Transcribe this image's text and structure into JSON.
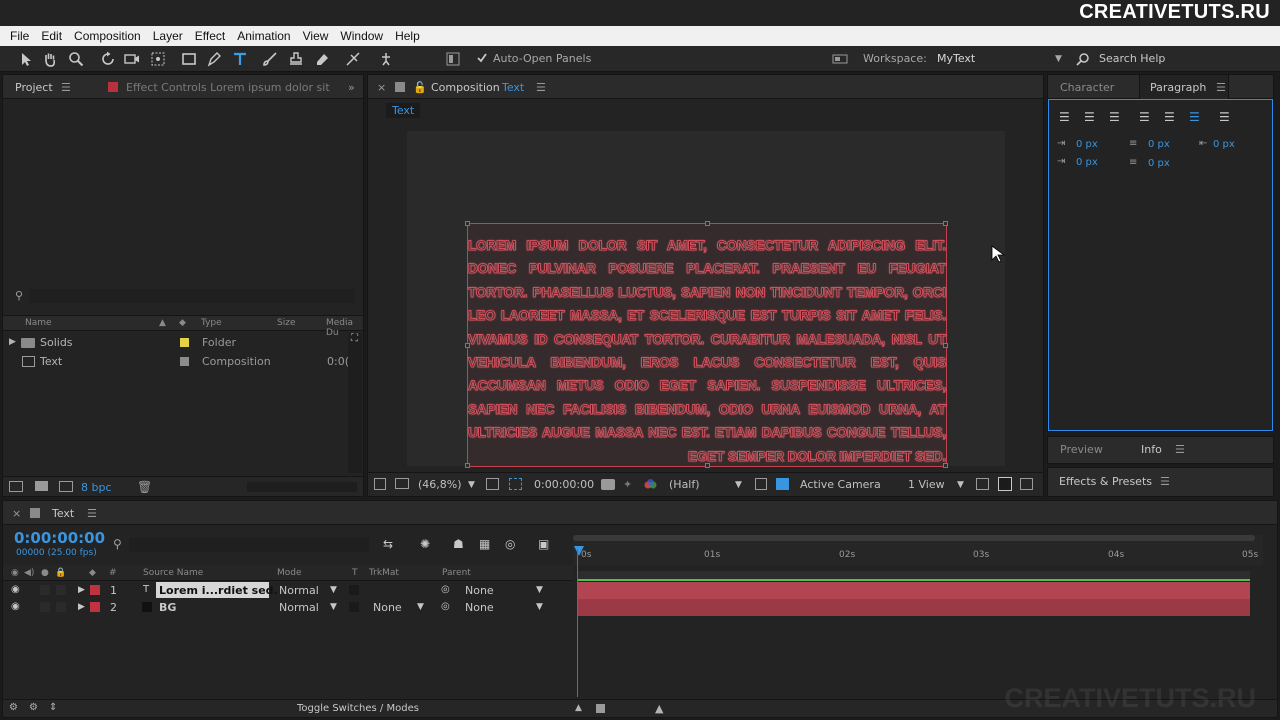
{
  "watermark": "CREATIVETUTS.RU",
  "menu": [
    "File",
    "Edit",
    "Composition",
    "Layer",
    "Effect",
    "Animation",
    "View",
    "Window",
    "Help"
  ],
  "toolbar": {
    "auto_open": "Auto-Open Panels",
    "workspace_label": "Workspace:",
    "workspace_value": "MyText",
    "search_help": "Search Help"
  },
  "project": {
    "tab": "Project",
    "effect_controls": "Effect Controls Lorem ipsum dolor sit",
    "columns": {
      "name": "Name",
      "type": "Type",
      "size": "Size",
      "media": "Media Du"
    },
    "items": [
      {
        "name": "Solids",
        "type": "Folder",
        "label_color": "#e6d24a",
        "duration": ""
      },
      {
        "name": "Text",
        "type": "Composition",
        "label_color": "#8c8c8c",
        "duration": "0:0("
      }
    ],
    "bpc": "8 bpc"
  },
  "composition": {
    "tab_prefix": "Composition",
    "tab_name": "Text",
    "subtab": "Text",
    "text": "Lorem ipsum dolor sit amet, consectetur adipiscing elit. Donec pulvinar posuere placerat. Praesent eu feugiat tortor. Phasellus luctus, sapien non tincidunt tempor, orci leo laoreet massa, et scelerisque est turpis sit amet felis. Vivamus id consequat tortor. Curabitur malesuada, nisl ut vehicula bibendum, eros lacus consectetur est, quis accumsan metus odio eget sapien. Suspendisse ultrices, sapien nec facilisis bibendum, odio urna euismod urna, at ultricies augue massa nec est. Etiam dapibus congue tellus, eget semper dolor imperdiet sed.",
    "zoom": "(46,8%)",
    "timecode": "0:00:00:00",
    "resolution": "(Half)",
    "camera": "Active Camera",
    "view": "1 View",
    "text_color": "#d0505c"
  },
  "character": {
    "tab_character": "Character",
    "tab_paragraph": "Paragraph"
  },
  "paragraph_values": {
    "indent_left": "0 px",
    "space_before": "0 px",
    "indent_right": "0 px",
    "first_line": "0 px",
    "space_after": "0 px"
  },
  "info": {
    "preview": "Preview",
    "info": "Info"
  },
  "effects": {
    "title": "Effects & Presets"
  },
  "timeline": {
    "tab": "Text",
    "timecode": "0:00:00:00",
    "frames": "00000 (25.00 fps)",
    "columns": {
      "num": "#",
      "source": "Source Name",
      "mode": "Mode",
      "t": "T",
      "trkmat": "TrkMat",
      "parent": "Parent"
    },
    "layers": [
      {
        "num": "1",
        "name": "Lorem i...rdiet sed.",
        "mode": "Normal",
        "trkmat": "",
        "parent": "None",
        "color": "#c0323f"
      },
      {
        "num": "2",
        "name": "BG",
        "mode": "Normal",
        "trkmat": "None",
        "parent": "None",
        "color": "#c0323f"
      }
    ],
    "ticks": [
      "0s",
      "01s",
      "02s",
      "03s",
      "04s",
      "05s"
    ],
    "toggle": "Toggle Switches / Modes"
  }
}
